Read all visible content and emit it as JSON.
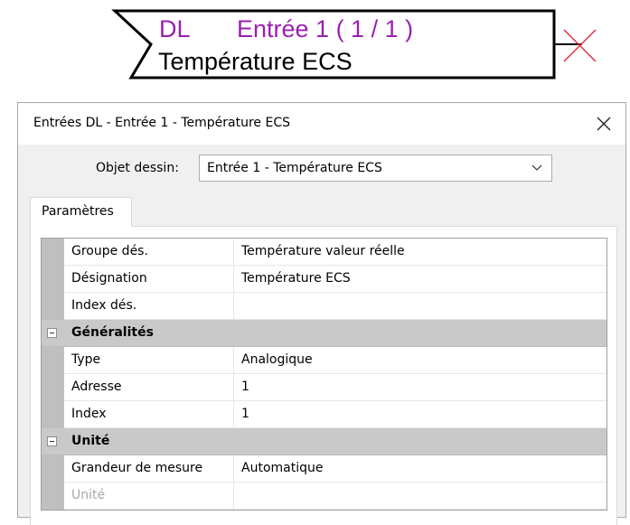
{
  "block": {
    "prefix": "DL",
    "title": "Entrée 1 ( 1 / 1 )",
    "name": "Température ECS"
  },
  "dialog": {
    "title": "Entrées DL - Entrée 1 - Température ECS",
    "object_label": "Objet dessin:",
    "object_value": "Entrée 1 - Température ECS",
    "tab": "Paramètres"
  },
  "grid": {
    "rows_top": [
      {
        "name": "Groupe dés.",
        "value": "Température valeur réelle"
      },
      {
        "name": "Désignation",
        "value": "Température ECS"
      },
      {
        "name": "Index dés.",
        "value": ""
      }
    ],
    "category1": "Généralités",
    "rows_gen": [
      {
        "name": "Type",
        "value": "Analogique"
      },
      {
        "name": "Adresse",
        "value": "1"
      },
      {
        "name": "Index",
        "value": "1"
      }
    ],
    "category2": "Unité",
    "rows_unit": [
      {
        "name": "Grandeur de mesure",
        "value": "Automatique"
      },
      {
        "name": "Unité",
        "value": ""
      }
    ]
  },
  "colors": {
    "block_title": "#9b1fb0",
    "marker": "#e0303a",
    "category_bg": "#c9c9c9",
    "gutter": "#bfbfbf"
  },
  "icons": {
    "close": "close-icon",
    "dropdown": "chevron-down-icon",
    "collapse": "minus-box-icon",
    "unconnected": "x-marker-icon"
  }
}
